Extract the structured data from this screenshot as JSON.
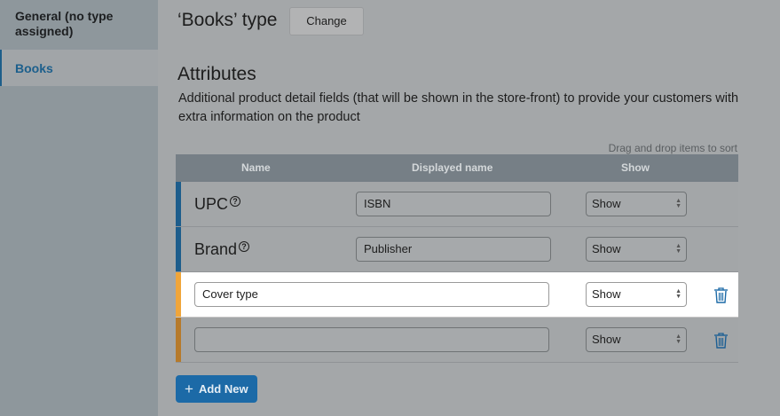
{
  "sidebar": {
    "items": [
      {
        "label": "General (no type assigned)"
      },
      {
        "label": "Books"
      }
    ]
  },
  "header": {
    "type_title": "‘Books’ type",
    "change_label": "Change"
  },
  "attributes": {
    "title": "Attributes",
    "description": "Additional product detail fields (that will be shown in the store-front) to provide your customers with extra information on the product",
    "drag_hint": "Drag and drop items to sort",
    "columns": {
      "name": "Name",
      "displayed": "Displayed name",
      "show": "Show"
    },
    "rows": [
      {
        "name": "UPC",
        "help": "?",
        "displayed": "ISBN",
        "show": "Show"
      },
      {
        "name": "Brand",
        "help": "?",
        "displayed": "Publisher",
        "show": "Show"
      },
      {
        "custom_value": "Cover type",
        "show": "Show"
      },
      {
        "custom_value": "",
        "show": "Show"
      }
    ],
    "add_new_label": "Add New",
    "add_icon": "+"
  },
  "colors": {
    "accent": "#1c6aa7",
    "active_bar": "#f0a53a",
    "system_bar": "#1d5d8c"
  }
}
